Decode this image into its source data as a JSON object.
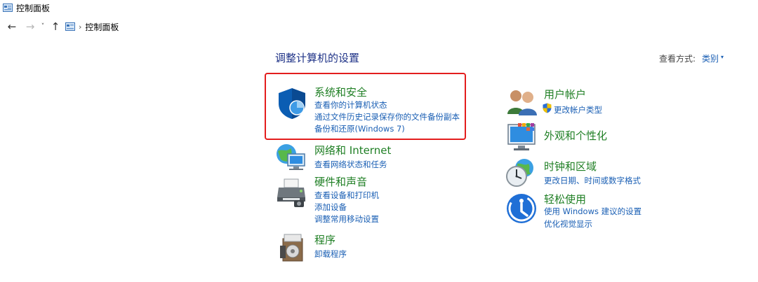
{
  "window": {
    "title": "控制面板"
  },
  "nav": {
    "back": "←",
    "forward": "→",
    "recent": "˅",
    "up": "↑",
    "breadcrumb_sep": "›",
    "breadcrumb": "控制面板"
  },
  "main": {
    "heading": "调整计算机的设置",
    "view_by_label": "查看方式:",
    "view_by_value": "类别",
    "view_by_caret": "▾"
  },
  "categories": {
    "system_security": {
      "title": "系统和安全",
      "links": [
        "查看你的计算机状态",
        "通过文件历史记录保存你的文件备份副本",
        "备份和还原(Windows 7)"
      ]
    },
    "network": {
      "title": "网络和 Internet",
      "links": [
        "查看网络状态和任务"
      ]
    },
    "hardware": {
      "title": "硬件和声音",
      "links": [
        "查看设备和打印机",
        "添加设备",
        "调整常用移动设置"
      ]
    },
    "programs": {
      "title": "程序",
      "links": [
        "卸载程序"
      ]
    },
    "user_accounts": {
      "title": "用户帐户",
      "links": [
        "更改帐户类型"
      ]
    },
    "appearance": {
      "title": "外观和个性化",
      "links": []
    },
    "clock_region": {
      "title": "时钟和区域",
      "links": [
        "更改日期、时间或数字格式"
      ]
    },
    "ease_access": {
      "title": "轻松使用",
      "links": [
        "使用 Windows 建议的设置",
        "优化视觉显示"
      ]
    }
  },
  "colors": {
    "category_title": "#1f7f24",
    "link": "#1a5fb4",
    "heading": "#1e3287",
    "highlight_border": "#e31d1d"
  }
}
